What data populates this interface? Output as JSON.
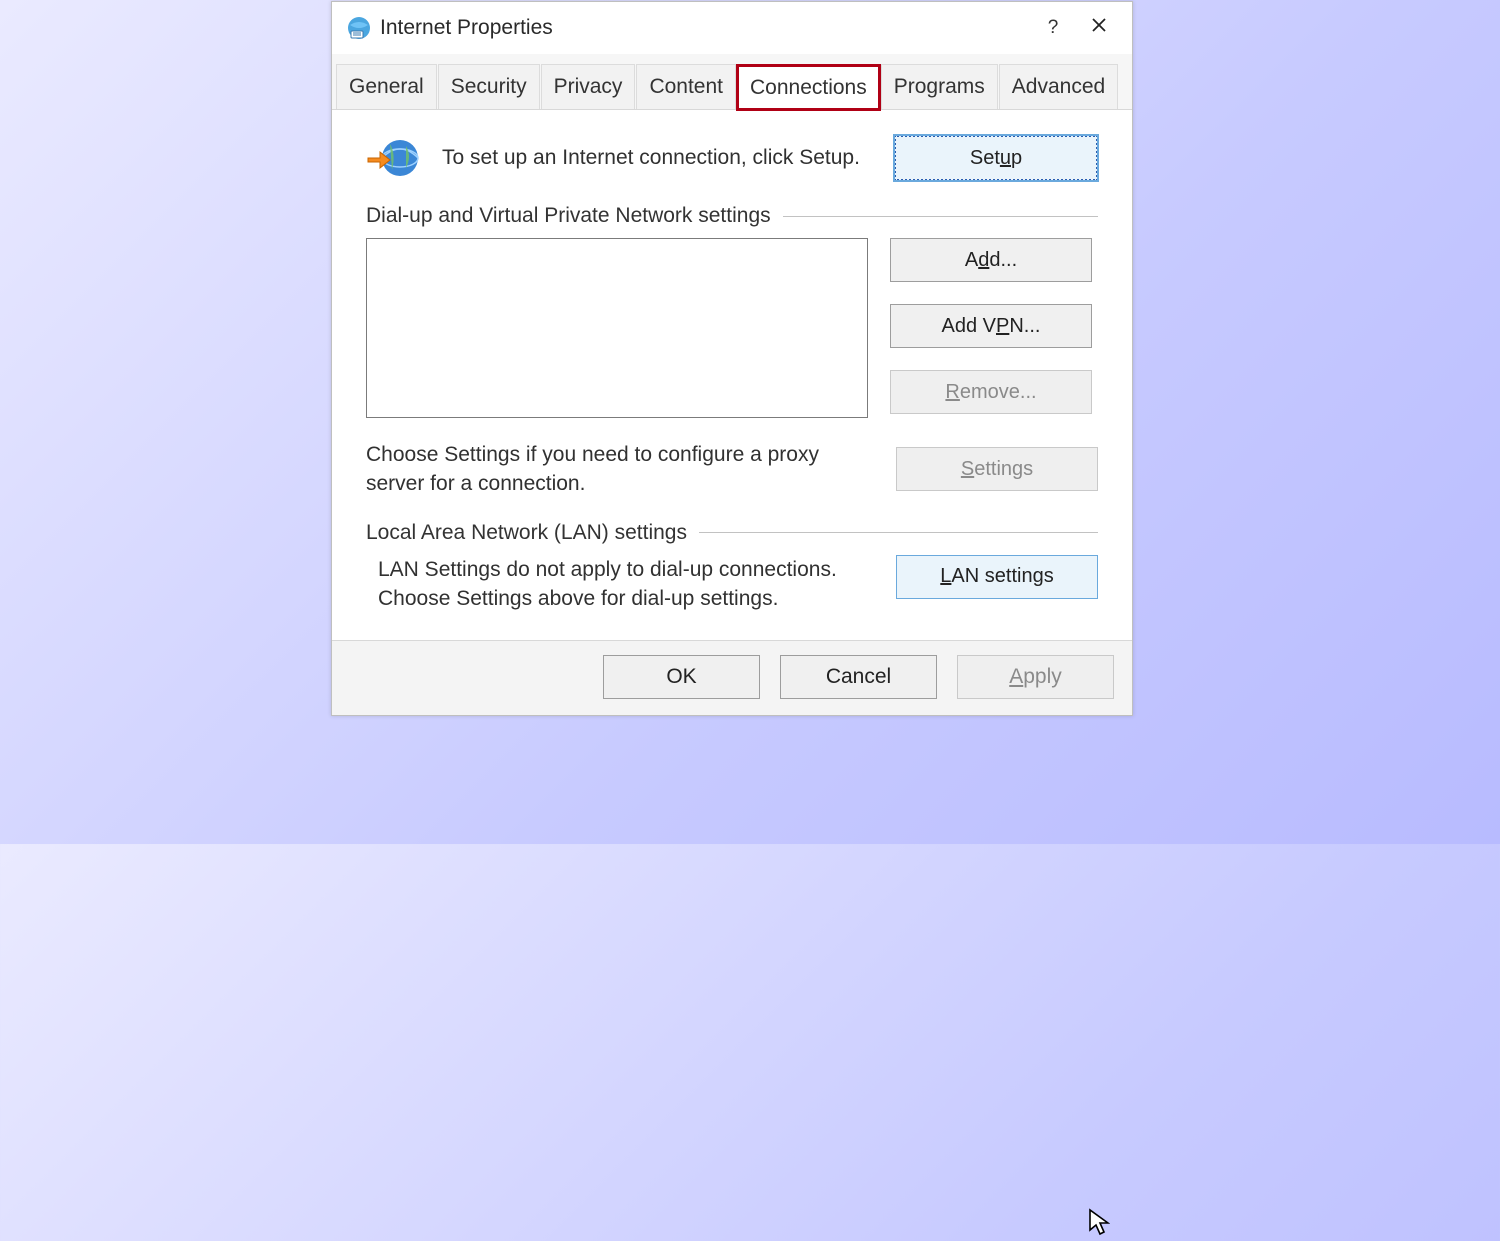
{
  "window": {
    "title": "Internet Properties"
  },
  "tabs": [
    {
      "label": "General"
    },
    {
      "label": "Security"
    },
    {
      "label": "Privacy"
    },
    {
      "label": "Content"
    },
    {
      "label": "Connections"
    },
    {
      "label": "Programs"
    },
    {
      "label": "Advanced"
    }
  ],
  "conn": {
    "intro": "To set up an Internet connection, click Setup.",
    "setup_label": "Setup",
    "dial_group": "Dial-up and Virtual Private Network settings",
    "add_label": "Add...",
    "add_vpn_label": "Add VPN...",
    "remove_label": "Remove...",
    "settings_label": "Settings",
    "proxy_hint": "Choose Settings if you need to configure a proxy server for a connection.",
    "lan_group": "Local Area Network (LAN) settings",
    "lan_hint": "LAN Settings do not apply to dial-up connections. Choose Settings above for dial-up settings.",
    "lan_button": "LAN settings"
  },
  "footer": {
    "ok": "OK",
    "cancel": "Cancel",
    "apply": "Apply"
  }
}
